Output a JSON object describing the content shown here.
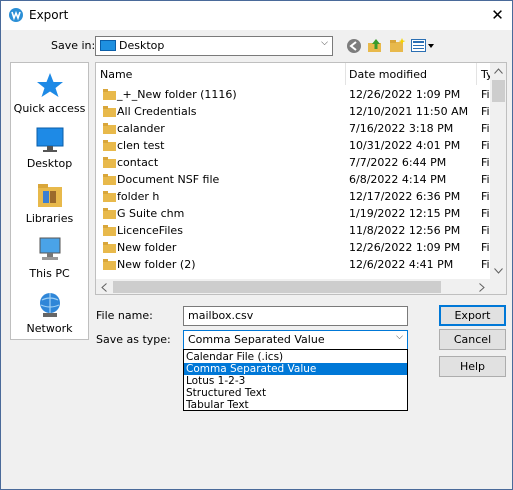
{
  "window": {
    "title": "Export",
    "close_glyph": "✕"
  },
  "toolbar": {
    "save_in_label": "Save in:",
    "save_in_value": "Desktop",
    "icons": [
      "back-icon",
      "up-folder-icon",
      "new-folder-icon",
      "view-menu-icon"
    ]
  },
  "places": [
    {
      "label": "Quick access",
      "icon": "star-icon"
    },
    {
      "label": "Desktop",
      "icon": "desktop-icon"
    },
    {
      "label": "Libraries",
      "icon": "libraries-icon"
    },
    {
      "label": "This PC",
      "icon": "computer-icon"
    },
    {
      "label": "Network",
      "icon": "network-icon"
    }
  ],
  "file_list": {
    "columns": {
      "name": "Name",
      "date": "Date modified",
      "type": "Ty"
    },
    "rows": [
      {
        "name": "_+_New folder (1116)",
        "date": "12/26/2022 1:09 PM",
        "type": "Fil"
      },
      {
        "name": "All Credentials",
        "date": "12/10/2021 11:50 AM",
        "type": "Fil"
      },
      {
        "name": "calander",
        "date": "7/16/2022 3:18 PM",
        "type": "Fil"
      },
      {
        "name": "clen test",
        "date": "10/31/2022 4:01 PM",
        "type": "Fil"
      },
      {
        "name": "contact",
        "date": "7/7/2022 6:44 PM",
        "type": "Fil"
      },
      {
        "name": "Document NSF file",
        "date": "6/8/2022 4:14 PM",
        "type": "Fil"
      },
      {
        "name": "folder h",
        "date": "12/17/2022 6:36 PM",
        "type": "Fil"
      },
      {
        "name": "G Suite chm",
        "date": "1/19/2022 12:15 PM",
        "type": "Fil"
      },
      {
        "name": "LicenceFiles",
        "date": "11/8/2022 12:56 PM",
        "type": "Fil"
      },
      {
        "name": "New folder",
        "date": "12/26/2022 1:09 PM",
        "type": "Fil"
      },
      {
        "name": "New folder (2)",
        "date": "12/6/2022 4:41 PM",
        "type": "Fil"
      }
    ]
  },
  "form": {
    "file_name_label": "File name:",
    "file_name_value": "mailbox.csv",
    "save_type_label": "Save as type:",
    "save_type_value": "Comma Separated Value",
    "type_options": [
      "Calendar File (.ics)",
      "Comma Separated Value",
      "Lotus 1-2-3",
      "Structured Text",
      "Tabular Text"
    ],
    "selected_option": 1
  },
  "buttons": {
    "export": "Export",
    "cancel": "Cancel",
    "help": "Help"
  },
  "colors": {
    "accent": "#0078d7",
    "folder": "#e8b94b",
    "background": "#f0f0f0"
  }
}
